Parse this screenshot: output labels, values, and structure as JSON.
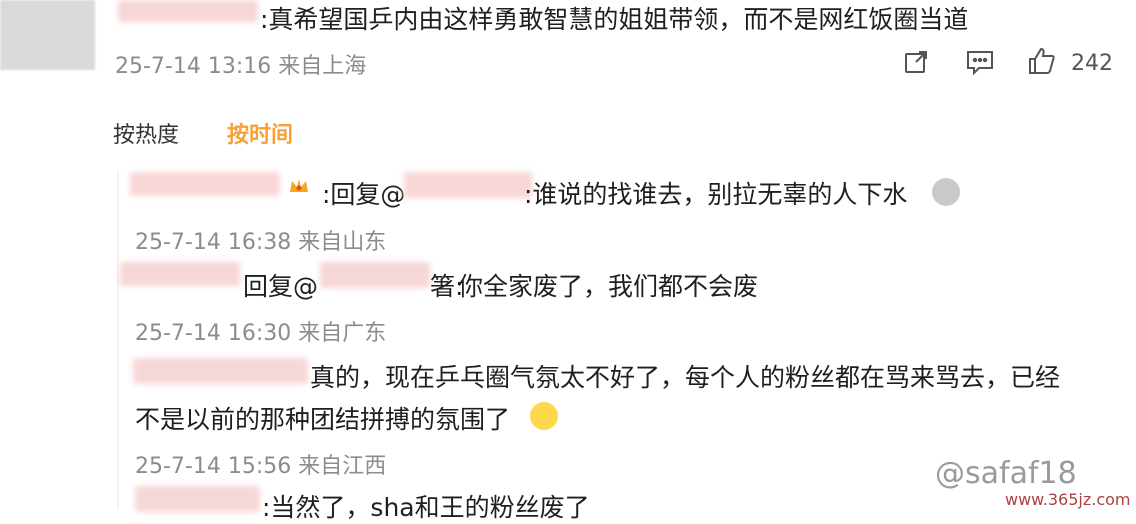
{
  "top_comment": {
    "text": ":真希望国乒内由这样勇敢智慧的姐姐带领，而不是网红饭圈当道",
    "timestamp": "25-7-14 13:16 来自上海",
    "like_count": "242"
  },
  "sort_tabs": {
    "by_heat": "按热度",
    "by_time": "按时间"
  },
  "replies": [
    {
      "prefix": ":回复@",
      "text": ":谁说的找谁去，别拉无辜的人下水",
      "timestamp": "25-7-14 16:38 来自山东"
    },
    {
      "prefix": "回复@",
      "text": "你全家废了，我们都不会废",
      "fragment": "箸:",
      "timestamp": "25-7-14 16:30 来自广东"
    },
    {
      "text_line1": "真的，现在乒乓圈气氛太不好了，每个人的粉丝都在骂来骂去，已经",
      "text_line2": "不是以前的那种团结拼搏的氛围了",
      "timestamp": "25-7-14 15:56 来自江西"
    },
    {
      "text": ":当然了，sha和王的粉丝废了"
    }
  ],
  "watermark": {
    "handle": "@safaf18",
    "site": "www.365jz.com"
  },
  "icons": {
    "share": "share-icon",
    "comment": "comment-icon",
    "like": "like-icon",
    "crown": "crown-icon"
  }
}
